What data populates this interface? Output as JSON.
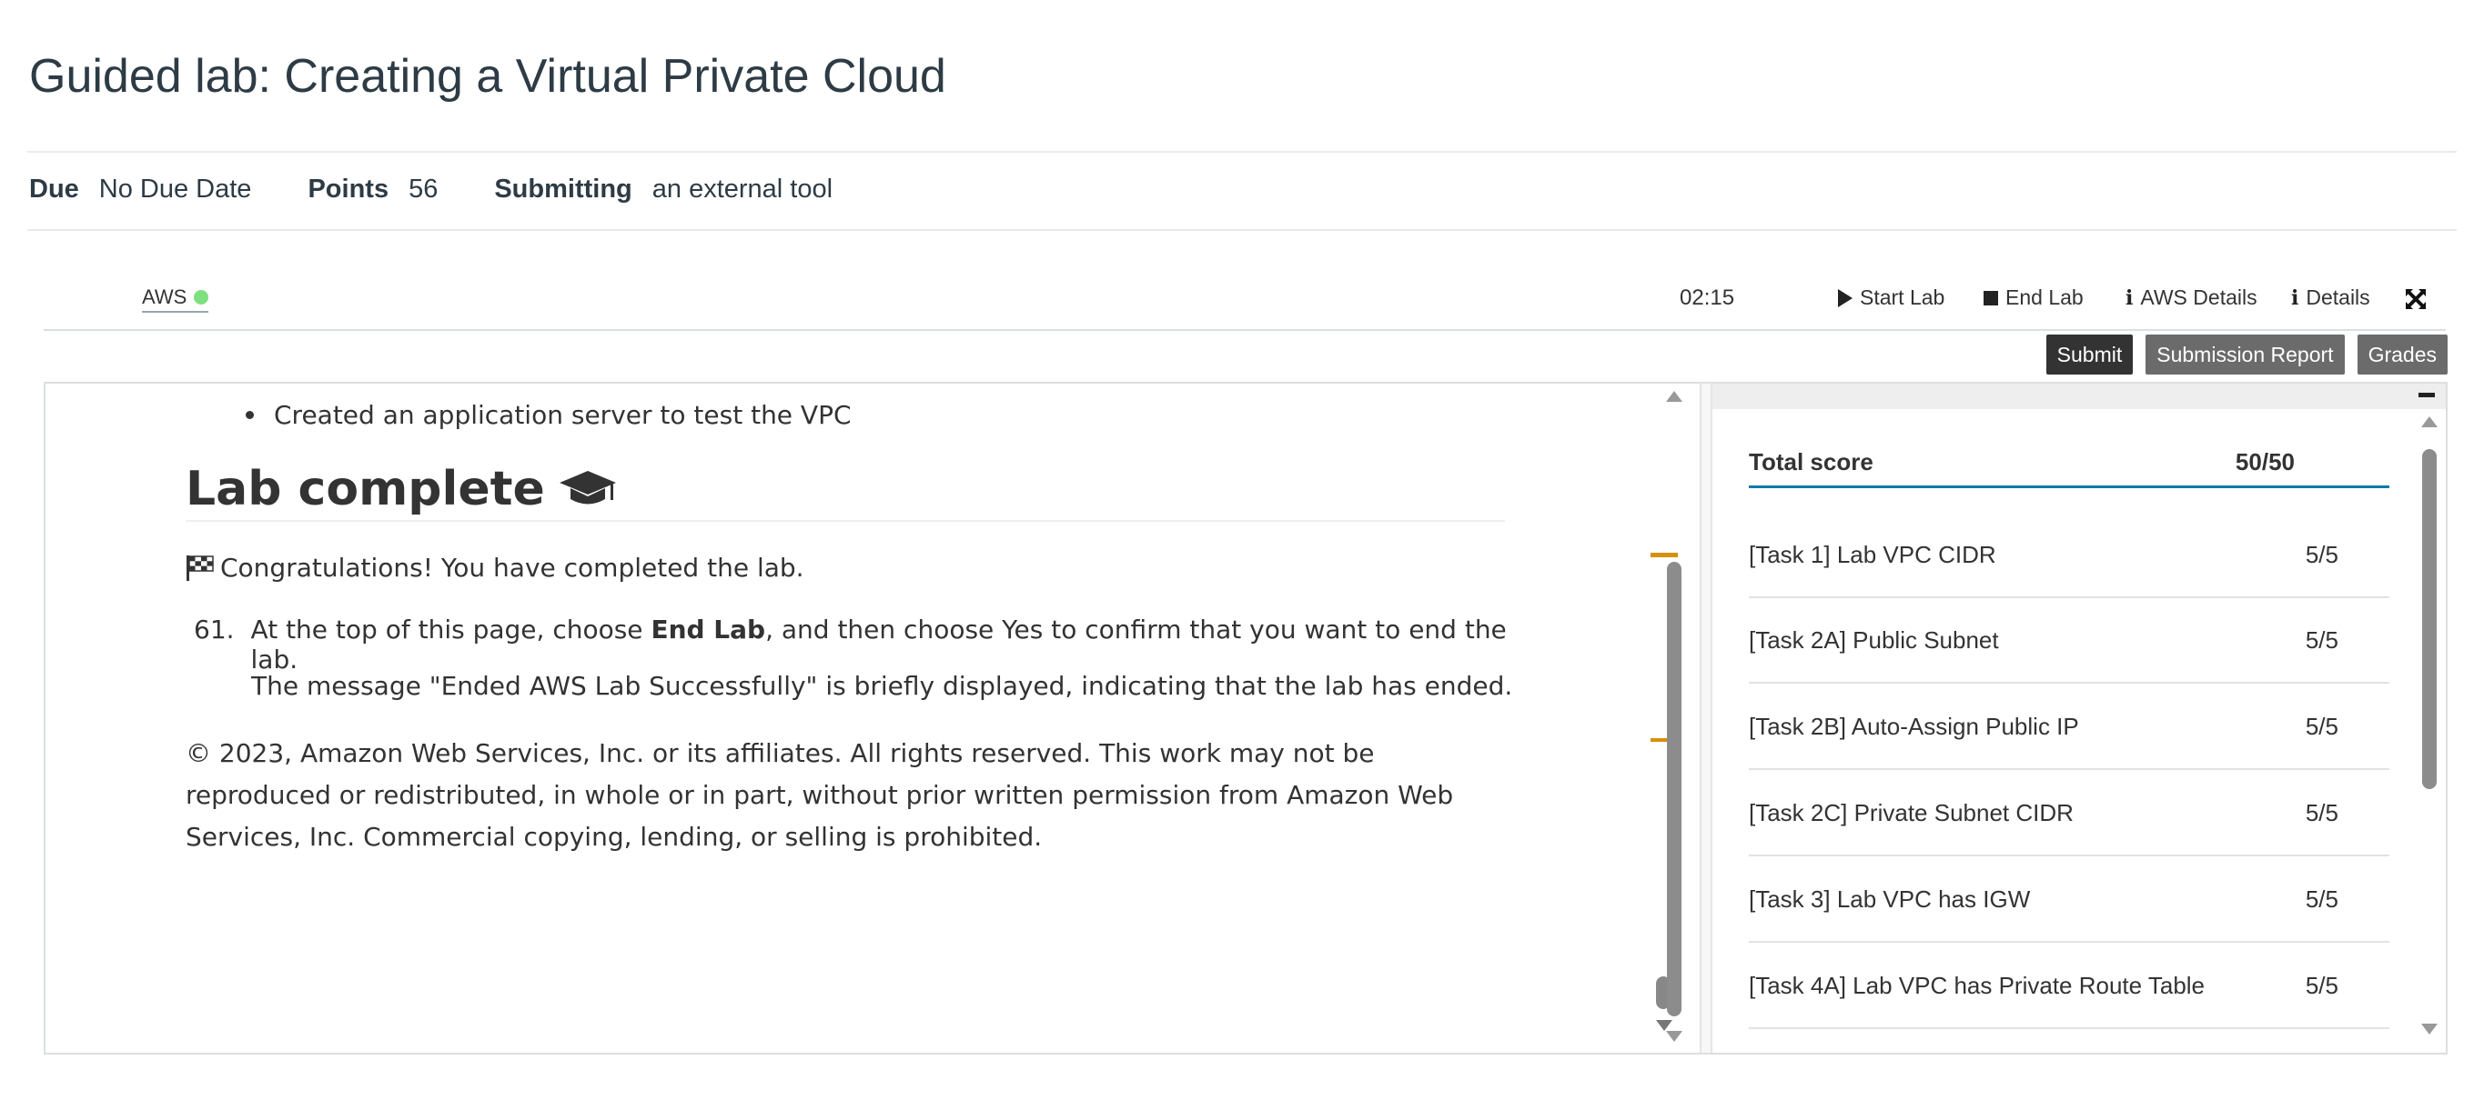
{
  "page": {
    "title": "Guided lab: Creating a Virtual Private Cloud"
  },
  "meta": {
    "due_label": "Due",
    "due_value": "No Due Date",
    "points_label": "Points",
    "points_value": "56",
    "submitting_label": "Submitting",
    "submitting_value": "an external tool"
  },
  "toolbar": {
    "aws_label": "AWS",
    "aws_status_color": "#7ee07e",
    "timer": "02:15",
    "start_lab": "Start Lab",
    "end_lab": "End Lab",
    "aws_details": "AWS Details",
    "details": "Details",
    "info_glyph": "i"
  },
  "actions": {
    "submit": "Submit",
    "submission_report": "Submission Report",
    "grades": "Grades"
  },
  "content": {
    "bullet": "Created an application server to test the VPC",
    "lab_heading": "Lab complete",
    "congrats": "Congratulations! You have completed the lab.",
    "step_number": "61.",
    "step_pre": "At the top of this page, choose ",
    "step_bold": "End Lab",
    "step_post": ", and then choose Yes to confirm that you want to end the lab.",
    "message": "The message \"Ended AWS Lab Successfully\" is briefly displayed, indicating that the lab has ended.",
    "copyright": "© 2023, Amazon Web Services, Inc. or its affiliates. All rights reserved. This work may not be reproduced or redistributed, in whole or in part, without prior written permission from Amazon Web Services, Inc. Commercial copying, lending, or selling is prohibited."
  },
  "score": {
    "total_label": "Total score",
    "total_value": "50/50",
    "rows": [
      {
        "label": "[Task 1] Lab VPC CIDR",
        "value": "5/5"
      },
      {
        "label": "[Task 2A] Public Subnet",
        "value": "5/5"
      },
      {
        "label": "[Task 2B] Auto-Assign Public IP",
        "value": "5/5"
      },
      {
        "label": "[Task 2C] Private Subnet CIDR",
        "value": "5/5"
      },
      {
        "label": "[Task 3] Lab VPC has IGW",
        "value": "5/5"
      },
      {
        "label": "[Task 4A] Lab VPC has Private Route Table",
        "value": "5/5"
      }
    ]
  },
  "colors": {
    "accent": "#0e7aa6",
    "scroll_marker": "#d6900a",
    "button_gray": "#6b6b6b",
    "button_dark": "#333333"
  }
}
